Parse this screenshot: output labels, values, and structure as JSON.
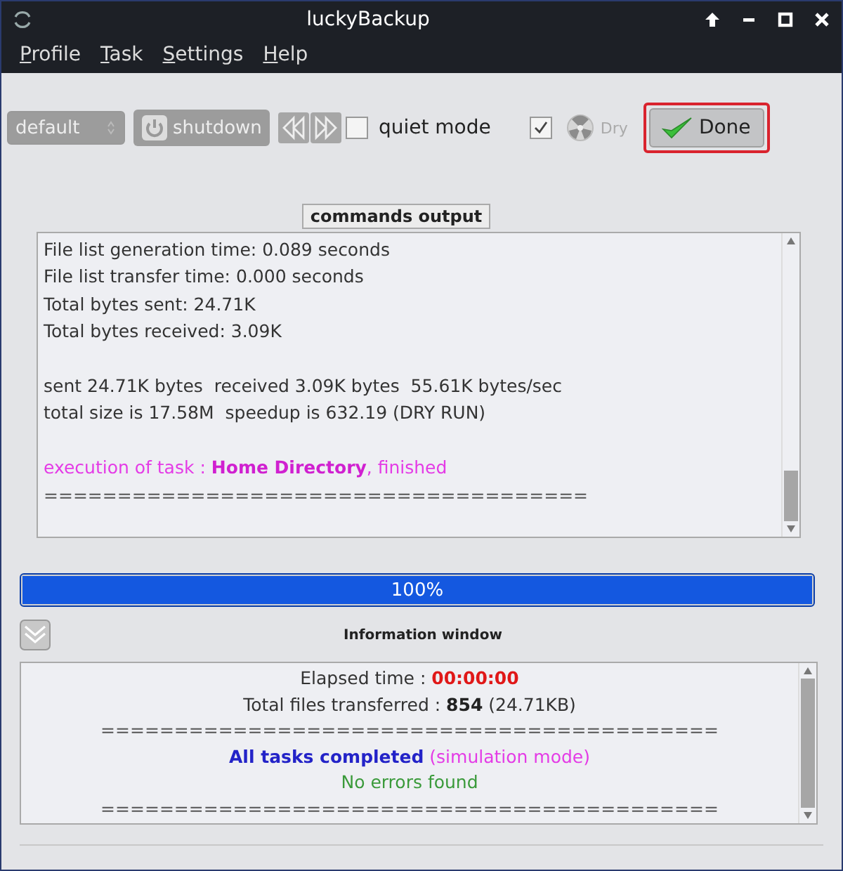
{
  "window": {
    "title": "luckyBackup"
  },
  "menu": [
    "Profile",
    "Task",
    "Settings",
    "Help"
  ],
  "toolbar": {
    "profile_combo": {
      "value": "default",
      "disabled": true
    },
    "shutdown_button": {
      "label": "shutdown",
      "disabled": true
    },
    "quiet_mode": {
      "label": "quiet mode",
      "checked": false
    },
    "dry_run": {
      "label": "Dry",
      "checked": true
    },
    "done_button": {
      "label": "Done",
      "focused": true
    }
  },
  "commands_output": {
    "title": "commands output",
    "lines": [
      [
        {
          "text": "File list generation time: 0.089 seconds",
          "kind": "plain"
        }
      ],
      [
        {
          "text": "File list transfer time: 0.000 seconds",
          "kind": "plain"
        }
      ],
      [
        {
          "text": "Total bytes sent: 24.71K",
          "kind": "plain"
        }
      ],
      [
        {
          "text": "Total bytes received: 3.09K",
          "kind": "plain"
        }
      ],
      [
        {
          "gap_before": true,
          "text": "sent 24.71K bytes  received 3.09K bytes  55.61K bytes/sec",
          "kind": "plain"
        }
      ],
      [
        {
          "text": "total size is 17.58M  speedup is 632.19 (DRY RUN)",
          "kind": "plain"
        }
      ],
      [
        {
          "gap_before": true,
          "text": "execution of task : ",
          "kind": "magenta"
        },
        {
          "text": "Home Directory",
          "kind": "magenta-bold"
        },
        {
          "text": ", finished",
          "kind": "magenta"
        }
      ],
      [
        {
          "text": "=====================================",
          "kind": "rule"
        }
      ]
    ]
  },
  "progress": {
    "label": "100%",
    "level": 1
  },
  "information": {
    "title": "Information window",
    "lines": [
      [
        {
          "text": "Elapsed time : ",
          "kind": "plain"
        },
        {
          "text": "00:00:00",
          "kind": "red-bold"
        }
      ],
      [
        {
          "text": "Total files transferred : ",
          "kind": "plain"
        },
        {
          "text": "854",
          "kind": "bold"
        },
        {
          "text": " (24.71KB)",
          "kind": "plain"
        }
      ],
      [
        {
          "text": "==========================================",
          "kind": "rule"
        }
      ],
      [
        {
          "text": "All tasks completed",
          "kind": "blue-bold"
        },
        {
          "text": " (simulation mode)",
          "kind": "magenta"
        }
      ],
      [
        {
          "text": "No errors found",
          "kind": "green"
        }
      ],
      [
        {
          "text": "==========================================",
          "kind": "rule"
        }
      ]
    ]
  }
}
